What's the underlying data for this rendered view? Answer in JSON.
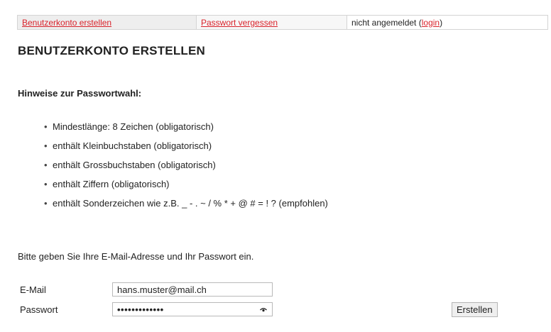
{
  "nav": {
    "create_account": "Benutzerkonto erstellen",
    "forgot_password": "Passwort vergessen",
    "status_prefix": "nicht angemeldet (",
    "login": "login",
    "status_suffix": ")"
  },
  "page_title": "BENUTZERKONTO ERSTELLEN",
  "hints": {
    "heading": "Hinweise zur Passwortwahl:",
    "items": [
      "Mindestlänge: 8 Zeichen (obligatorisch)",
      "enthält Kleinbuchstaben (obligatorisch)",
      "enthält Grossbuchstaben (obligatorisch)",
      "enthält Ziffern (obligatorisch)",
      "enthält Sonderzeichen wie z.B. _ - . ~ / % * + @ # = ! ? (empfohlen)"
    ],
    "bullet": "•"
  },
  "instruction": "Bitte geben Sie Ihre E-Mail-Adresse und Ihr Passwort ein.",
  "form": {
    "email_label": "E-Mail",
    "email_value": "hans.muster@mail.ch",
    "password_label": "Passwort",
    "password_masked": "•••••••••••••",
    "submit_label": "Erstellen",
    "password_toggle_icon": "eye-icon"
  },
  "colors": {
    "link": "#d9232b",
    "nav_bg": "#eeeeee"
  }
}
